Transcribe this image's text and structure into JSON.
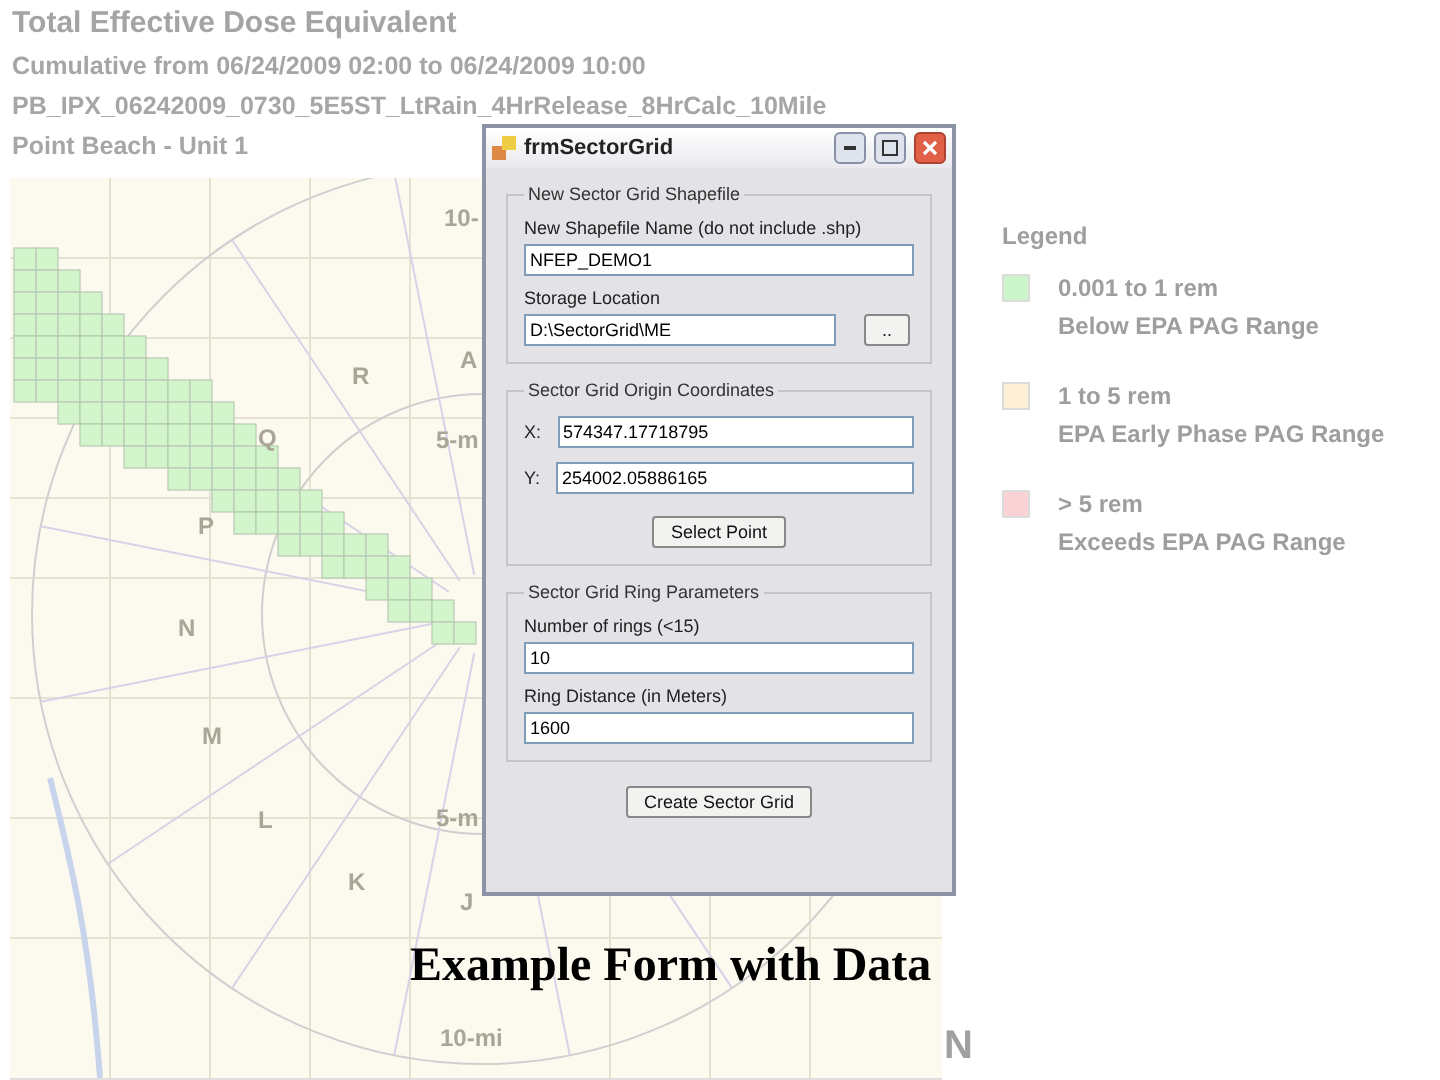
{
  "header": {
    "title": "Total Effective Dose Equivalent",
    "lines": [
      "Cumulative from 06/24/2009 02:00 to 06/24/2009 10:00",
      "PB_IPX_06242009_0730_5E5ST_LtRain_4HrRelease_8HrCalc_10Mile",
      "Point Beach - Unit 1"
    ]
  },
  "map": {
    "labels": [
      "10-",
      "A",
      "R",
      "Q",
      "5-m",
      "P",
      "N",
      "M",
      "5-m",
      "L",
      "K",
      "J",
      "10-mi"
    ],
    "north": "N"
  },
  "legend": {
    "title": "Legend",
    "items": [
      {
        "range": "0.001 to 1 rem",
        "description": "Below EPA PAG Range",
        "color": "#ccf5cc"
      },
      {
        "range": "1 to 5 rem",
        "description": "EPA Early Phase PAG Range",
        "color": "#fdf0d4"
      },
      {
        "range": "> 5 rem",
        "description": "Exceeds EPA PAG Range",
        "color": "#f9d2d6"
      }
    ]
  },
  "dialog": {
    "title": "frmSectorGrid",
    "groups": [
      {
        "title": "New Sector Grid Shapefile",
        "fields": [
          {
            "kind": "stacked",
            "label": "New Shapefile Name (do not include .shp)",
            "value": "NFEP_DEMO1"
          },
          {
            "kind": "stacked",
            "label": "Storage Location",
            "value": "D:\\SectorGrid\\ME",
            "browse": ".."
          }
        ]
      },
      {
        "title": "Sector Grid Origin Coordinates",
        "fields": [
          {
            "kind": "inline",
            "label": "X:",
            "value": "574347.17718795"
          },
          {
            "kind": "inline",
            "label": "Y:",
            "value": "254002.05886165"
          }
        ],
        "button": "Select Point"
      },
      {
        "title": "Sector Grid Ring Parameters",
        "fields": [
          {
            "kind": "stacked",
            "label": "Number of rings (<15)",
            "value": "10"
          },
          {
            "kind": "stacked",
            "label": "Ring Distance (in Meters)",
            "value": "1600"
          }
        ]
      }
    ],
    "button": "Create Sector Grid"
  },
  "caption": "Example Form with Data"
}
